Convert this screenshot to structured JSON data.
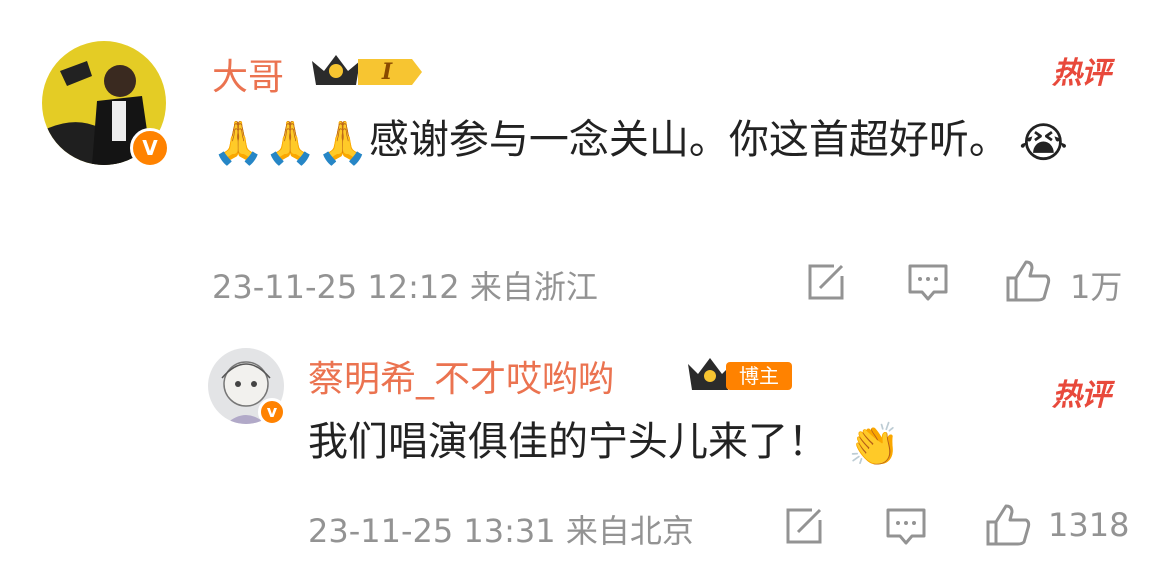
{
  "comments": [
    {
      "username": "大哥",
      "level_badge": "I",
      "hot_label": "热评",
      "text": "感谢参与一念关山。你这首超好听。",
      "emoji_prefix": "🙏🙏🙏",
      "emoji_suffix": "😭",
      "timestamp": "23-11-25 12:12",
      "location": "来自浙江",
      "likes": "1万",
      "verified_badge": "V"
    },
    {
      "username": "蔡明希_不才哎哟哟",
      "blogger_badge": "博主",
      "hot_label": "热评",
      "text": "我们唱演俱佳的宁头儿来了！",
      "emoji_suffix": "👏",
      "timestamp": "23-11-25 13:31",
      "location": "来自北京",
      "likes": "1318",
      "verified_badge": "v"
    }
  ],
  "icons": {
    "forward": "edit-icon",
    "comment": "comment-icon",
    "like": "thumbs-up-icon"
  },
  "colors": {
    "username": "#eb7350",
    "hot": "#e8493b",
    "meta": "#939393",
    "text": "#222222",
    "verified": "#ff8200"
  }
}
